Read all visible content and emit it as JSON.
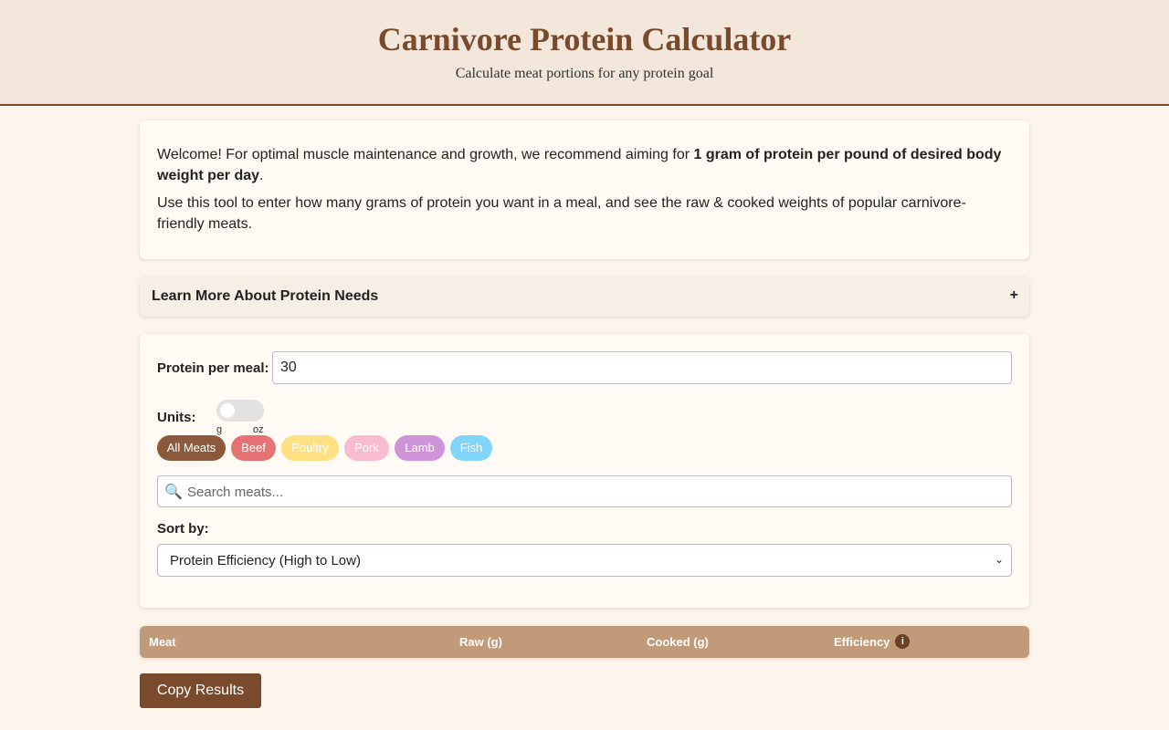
{
  "header": {
    "title": "Carnivore Protein Calculator",
    "subtitle": "Calculate meat portions for any protein goal"
  },
  "welcome": {
    "p1_before": "Welcome! For optimal muscle maintenance and growth, we recommend aiming for ",
    "p1_bold": "1 gram of protein per pound of desired body weight per day",
    "p1_after": ".",
    "p2": "Use this tool to enter how many grams of protein you want in a meal, and see the raw & cooked weights of popular carnivore-friendly meats."
  },
  "accordion": {
    "title": "Learn More About Protein Needs",
    "toggle": "+"
  },
  "controls": {
    "protein_label": "Protein per meal:",
    "protein_value": "30",
    "units_label": "Units:",
    "unit_left": "g",
    "unit_right": "oz",
    "filters": [
      {
        "label": "All Meats",
        "color": "#8b5a3c"
      },
      {
        "label": "Beef",
        "color": "#e57373"
      },
      {
        "label": "Poultry",
        "color": "#ffe082"
      },
      {
        "label": "Pork",
        "color": "#f8bbd0"
      },
      {
        "label": "Lamb",
        "color": "#ce93d8"
      },
      {
        "label": "Fish",
        "color": "#81d4fa"
      }
    ],
    "search_placeholder": "Search meats...",
    "sort_label": "Sort by:",
    "sort_value": "Protein Efficiency (High to Low)"
  },
  "table": {
    "columns": [
      "Meat",
      "Raw (g)",
      "Cooked (g)",
      "Efficiency"
    ],
    "info_icon": "i"
  },
  "actions": {
    "copy_label": "Copy Results"
  }
}
